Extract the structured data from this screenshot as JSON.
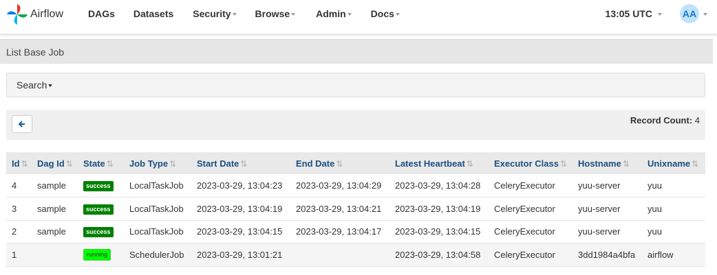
{
  "brand": {
    "name": "Airflow"
  },
  "nav": {
    "items": [
      {
        "label": "DAGs",
        "dropdown": false
      },
      {
        "label": "Datasets",
        "dropdown": false
      },
      {
        "label": "Security",
        "dropdown": true
      },
      {
        "label": "Browse",
        "dropdown": true
      },
      {
        "label": "Admin",
        "dropdown": true
      },
      {
        "label": "Docs",
        "dropdown": true
      }
    ],
    "clock": "13:05 UTC",
    "avatar_initials": "AA"
  },
  "page": {
    "title": "List Base Job"
  },
  "search": {
    "label": "Search"
  },
  "actions": {
    "record_count_label": "Record Count:",
    "record_count": "4"
  },
  "table": {
    "columns": [
      "Id",
      "Dag Id",
      "State",
      "Job Type",
      "Start Date",
      "End Date",
      "Latest Heartbeat",
      "Executor Class",
      "Hostname",
      "Unixname"
    ],
    "rows": [
      {
        "id": "4",
        "dag_id": "sample",
        "state": "success",
        "job_type": "LocalTaskJob",
        "start_date": "2023-03-29, 13:04:23",
        "end_date": "2023-03-29, 13:04:29",
        "latest_heartbeat": "2023-03-29, 13:04:28",
        "executor_class": "CeleryExecutor",
        "hostname": "yuu-server",
        "unixname": "yuu"
      },
      {
        "id": "3",
        "dag_id": "sample",
        "state": "success",
        "job_type": "LocalTaskJob",
        "start_date": "2023-03-29, 13:04:19",
        "end_date": "2023-03-29, 13:04:21",
        "latest_heartbeat": "2023-03-29, 13:04:19",
        "executor_class": "CeleryExecutor",
        "hostname": "yuu-server",
        "unixname": "yuu"
      },
      {
        "id": "2",
        "dag_id": "sample",
        "state": "success",
        "job_type": "LocalTaskJob",
        "start_date": "2023-03-29, 13:04:15",
        "end_date": "2023-03-29, 13:04:17",
        "latest_heartbeat": "2023-03-29, 13:04:15",
        "executor_class": "CeleryExecutor",
        "hostname": "yuu-server",
        "unixname": "yuu"
      },
      {
        "id": "1",
        "dag_id": "",
        "state": "running",
        "job_type": "SchedulerJob",
        "start_date": "2023-03-29, 13:01:21",
        "end_date": "",
        "latest_heartbeat": "2023-03-29, 13:04:58",
        "executor_class": "CeleryExecutor",
        "hostname": "3dd1984a4bfa",
        "unixname": "airflow"
      }
    ]
  },
  "colors": {
    "success": "#008000",
    "running": "#01ff01",
    "header_link": "#1b4f80"
  },
  "icons": {
    "back": "arrow-left-icon",
    "sort": "sort-icon",
    "logo": "airflow-pinwheel-logo"
  }
}
